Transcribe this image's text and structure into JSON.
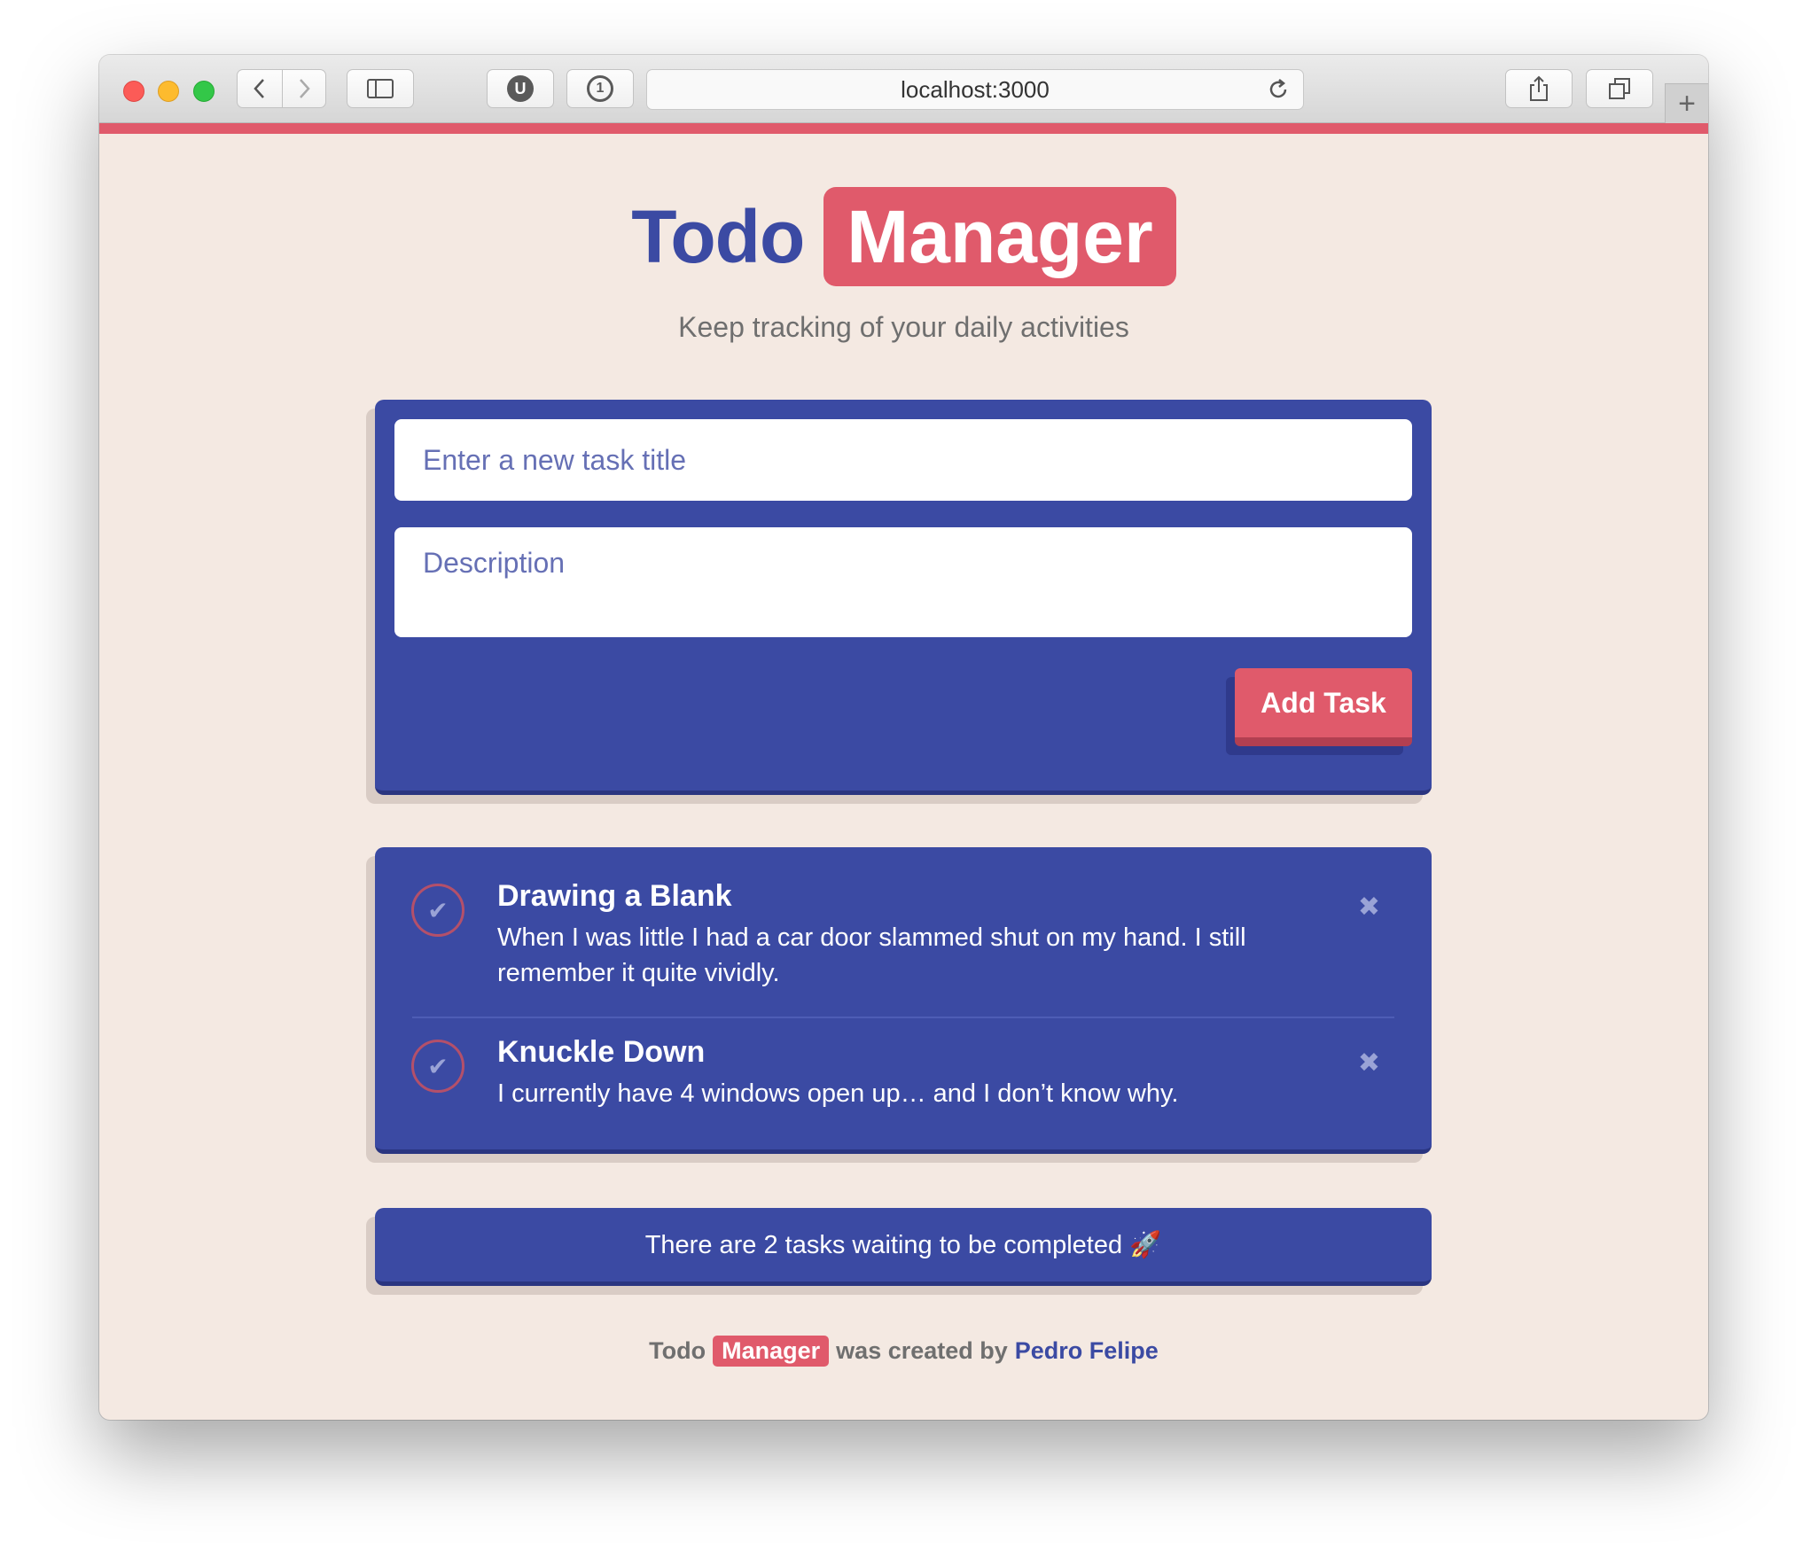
{
  "browser": {
    "url": "localhost:3000",
    "colors": {
      "accent_bar": "#e05a6b"
    },
    "icons": [
      "back-icon",
      "forward-icon",
      "sidebar-icon",
      "ublock-icon",
      "onepassword-icon",
      "reload-icon",
      "share-icon",
      "tabs-icon",
      "new-tab-icon"
    ],
    "ublock_glyph": "U",
    "onepassword_glyph": "1",
    "new_tab_glyph": "+"
  },
  "header": {
    "title_part1": "Todo",
    "title_part2": "Manager",
    "subtitle": "Keep tracking of your daily activities"
  },
  "form": {
    "title_placeholder": "Enter a new task title",
    "description_placeholder": "Description",
    "add_button": "Add Task"
  },
  "tasks": [
    {
      "title": "Drawing a Blank",
      "description": "When I was little I had a car door slammed shut on my hand. I still remember it quite vividly.",
      "check_glyph": "✔",
      "delete_glyph": "✖"
    },
    {
      "title": "Knuckle Down",
      "description": "I currently have 4 windows open up… and I don’t know why.",
      "check_glyph": "✔",
      "delete_glyph": "✖"
    }
  ],
  "status": {
    "text": "There are 2 tasks waiting to be completed 🚀"
  },
  "footer": {
    "todo": "Todo",
    "manager": "Manager",
    "created_by": "was created by",
    "author": "Pedro Felipe"
  },
  "colors": {
    "primary": "#3b4aa3",
    "accent": "#e05a6b",
    "background": "#f4e9e2"
  }
}
